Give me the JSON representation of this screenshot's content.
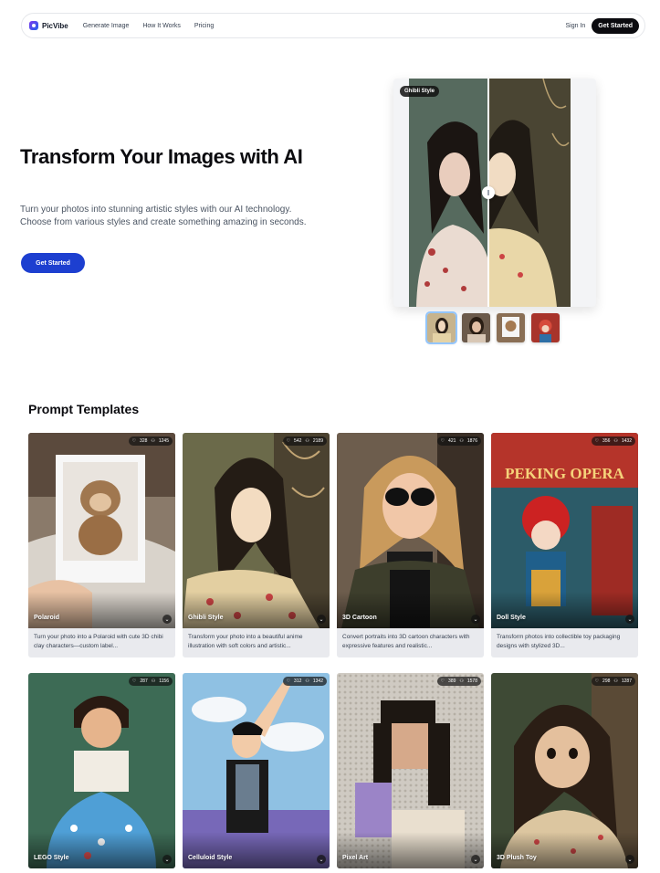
{
  "nav": {
    "brand": "PicVibe",
    "links": [
      "Generate Image",
      "How It Works",
      "Pricing"
    ],
    "sign_in": "Sign In",
    "cta": "Get Started"
  },
  "hero": {
    "title": "Transform Your Images with AI",
    "subtitle": "Turn your photos into stunning artistic styles with our AI technology. Choose from various styles and create something amazing in seconds.",
    "cta": "Get Started",
    "compare_badge": "Ghibli Style"
  },
  "templates": {
    "title": "Prompt Templates",
    "cards": [
      {
        "name": "Polaroid",
        "likes": "328",
        "uses": "1245",
        "desc": "Turn your photo into a Polaroid with cute 3D chibi clay characters—custom label..."
      },
      {
        "name": "Ghibli Style",
        "likes": "542",
        "uses": "2189",
        "desc": "Transform your photo into a beautiful anime illustration with soft colors and artistic..."
      },
      {
        "name": "3D Cartoon",
        "likes": "421",
        "uses": "1876",
        "desc": "Convert portraits into 3D cartoon characters with expressive features and realistic..."
      },
      {
        "name": "Doll Style",
        "likes": "356",
        "uses": "1432",
        "desc": "Transform photos into collectible toy packaging designs with stylized 3D..."
      },
      {
        "name": "LEGO Style",
        "likes": "287",
        "uses": "1156",
        "desc": ""
      },
      {
        "name": "Celluloid Style",
        "likes": "312",
        "uses": "1342",
        "desc": ""
      },
      {
        "name": "Pixel Art",
        "likes": "389",
        "uses": "1578",
        "desc": ""
      },
      {
        "name": "3D Plush Toy",
        "likes": "298",
        "uses": "1287",
        "desc": ""
      }
    ],
    "peking_text": "PEKING OPERA"
  },
  "colors": {
    "primary": "#1d3fd0",
    "dark": "#0b0b0f"
  }
}
